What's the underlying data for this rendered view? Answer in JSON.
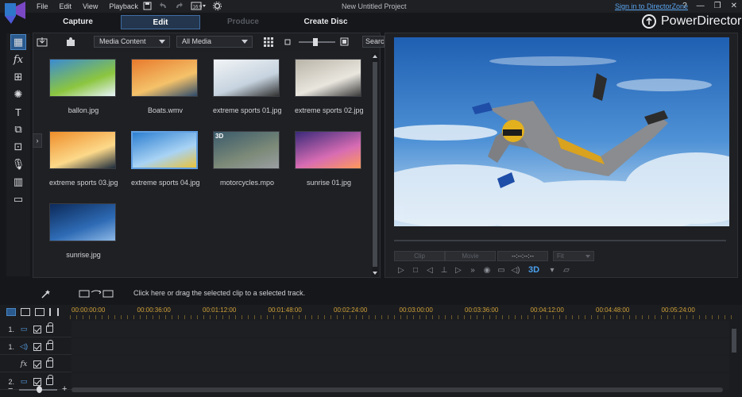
{
  "window": {
    "menu": [
      "File",
      "Edit",
      "View",
      "Playback"
    ],
    "project_title": "New Untitled Project",
    "signin_link": "Sign in to DirectorZone",
    "window_buttons": [
      "?",
      "—",
      "❐",
      "✕"
    ]
  },
  "mode_tabs": [
    {
      "label": "Capture",
      "state": "normal"
    },
    {
      "label": "Edit",
      "state": "active"
    },
    {
      "label": "Produce",
      "state": "disabled"
    },
    {
      "label": "Create Disc",
      "state": "normal"
    }
  ],
  "brand": {
    "name": "PowerDirector"
  },
  "left_tools": [
    {
      "name": "media-room-icon",
      "glyph": "▦"
    },
    {
      "name": "fx-room-icon",
      "glyph": "fx"
    },
    {
      "name": "pip-room-icon",
      "glyph": "⊞"
    },
    {
      "name": "particle-room-icon",
      "glyph": "✺"
    },
    {
      "name": "title-room-icon",
      "glyph": "T"
    },
    {
      "name": "transition-room-icon",
      "glyph": "⧉"
    },
    {
      "name": "audio-mixing-room-icon",
      "glyph": "⊡"
    },
    {
      "name": "voiceover-room-icon",
      "glyph": "🎙"
    },
    {
      "name": "chapter-room-icon",
      "glyph": "▥"
    },
    {
      "name": "subtitle-room-icon",
      "glyph": "▭"
    }
  ],
  "library": {
    "content_dropdown": "Media Content",
    "filter_dropdown": "All Media",
    "search_placeholder": "Search",
    "expand_glyph": "›",
    "items": [
      {
        "name": "ballon.jpg",
        "selected": false,
        "is3d": false
      },
      {
        "name": "Boats.wmv",
        "selected": false,
        "is3d": false
      },
      {
        "name": "extreme sports 01.jpg",
        "selected": false,
        "is3d": false
      },
      {
        "name": "extreme sports 02.jpg",
        "selected": false,
        "is3d": false
      },
      {
        "name": "extreme sports 03.jpg",
        "selected": false,
        "is3d": false
      },
      {
        "name": "extreme sports 04.jpg",
        "selected": true,
        "is3d": false
      },
      {
        "name": "motorcycles.mpo",
        "selected": false,
        "is3d": true
      },
      {
        "name": "sunrise 01.jpg",
        "selected": false,
        "is3d": false
      },
      {
        "name": "sunrise.jpg",
        "selected": false,
        "is3d": false
      }
    ],
    "badge_3d": "3D"
  },
  "preview": {
    "mode_clip": "Clip",
    "mode_movie": "Movie",
    "timecode": "--:--:--:--",
    "fit": "Fit",
    "label_3d": "3D"
  },
  "midbar": {
    "tip": "Click here or drag the selected clip to a selected track."
  },
  "timeline": {
    "ticks": [
      "00:00:00:00",
      "00:00:36:00",
      "00:01:12:00",
      "00:01:48:00",
      "00:02:24:00",
      "00:03:00:00",
      "00:03:36:00",
      "00:04:12:00",
      "00:04:48:00",
      "00:05:24:00"
    ],
    "tracks": [
      {
        "label": "1.",
        "icon": "video-track-icon",
        "glyph": "▭"
      },
      {
        "label": "1.",
        "icon": "audio-track-icon",
        "glyph": "◁)"
      },
      {
        "label": "",
        "icon": "fx-track-icon",
        "glyph": "fx"
      },
      {
        "label": "2.",
        "icon": "video-track-icon",
        "glyph": "▭"
      }
    ]
  },
  "colors": {
    "accent": "#3f6da2",
    "selection": "#62a0e2",
    "timecode": "#d0a23a",
    "link": "#5aa6f0"
  }
}
